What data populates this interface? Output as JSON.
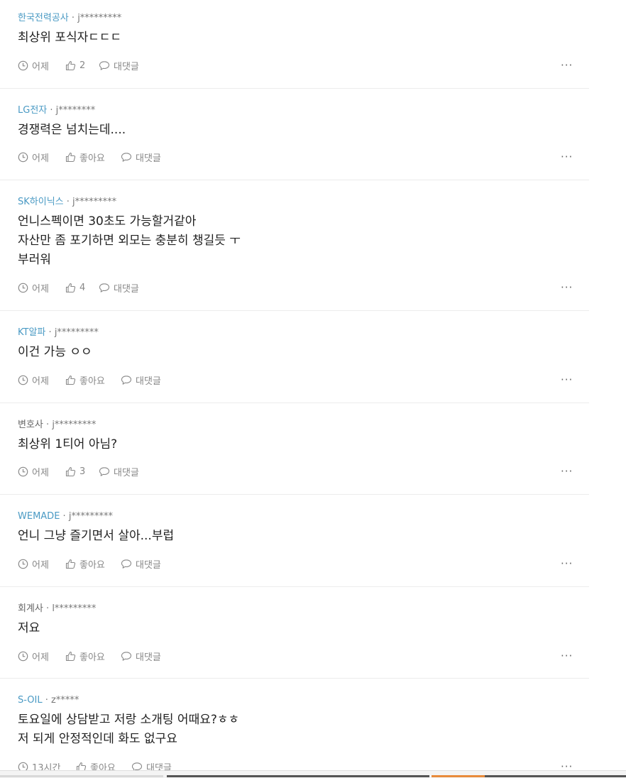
{
  "comments": [
    {
      "company": "한국전력공사",
      "user": "j*********",
      "lines": [
        "최상위 포식자ㄷㄷㄷ"
      ],
      "time": "어제",
      "likes": "2",
      "reply": "대댓글"
    },
    {
      "company": "LG전자",
      "user": "j********",
      "lines": [
        "경쟁력은 넘치는데...."
      ],
      "time": "어제",
      "likes": "좋아요",
      "reply": "대댓글"
    },
    {
      "company": "SK하이닉스",
      "user": "j*********",
      "lines": [
        "언니스펙이면 30초도 가능할거같아",
        "자산만 좀 포기하면 외모는 충분히 챙길듯 ㅜ",
        "부러워"
      ],
      "time": "어제",
      "likes": "4",
      "reply": "대댓글"
    },
    {
      "company": "KT알파",
      "user": "j*********",
      "lines": [
        "이건 가능 ㅇㅇ"
      ],
      "time": "어제",
      "likes": "좋아요",
      "reply": "대댓글"
    },
    {
      "company": "변호사",
      "user": "j*********",
      "lines": [
        "최상위 1티어 아님?"
      ],
      "time": "어제",
      "likes": "3",
      "reply": "대댓글"
    },
    {
      "company": "WEMADE",
      "user": "j*********",
      "lines": [
        "언니 그냥 즐기면서 살아...부럽"
      ],
      "time": "어제",
      "likes": "좋아요",
      "reply": "대댓글"
    },
    {
      "company": "회계사",
      "user": "l*********",
      "lines": [
        "저요"
      ],
      "time": "어제",
      "likes": "좋아요",
      "reply": "대댓글"
    },
    {
      "company": "S-OIL",
      "user": "z*****",
      "lines": [
        "토요일에 상담받고 저랑 소개팅 어때요?ㅎㅎ",
        "저 되게 안정적인데 화도 없구요"
      ],
      "time": "13시간",
      "likes": "좋아요",
      "reply": "대댓글"
    }
  ],
  "more_label": "···",
  "separator": "·",
  "colors": {
    "company_link": "#4a9ac4",
    "company_plain": "#666666",
    "meta_text": "#888888",
    "body_text": "#222222",
    "divider": "#ececec"
  },
  "icons": [
    "clock-icon",
    "thumbs-up-icon",
    "speech-bubble-icon",
    "more-dots-icon"
  ]
}
